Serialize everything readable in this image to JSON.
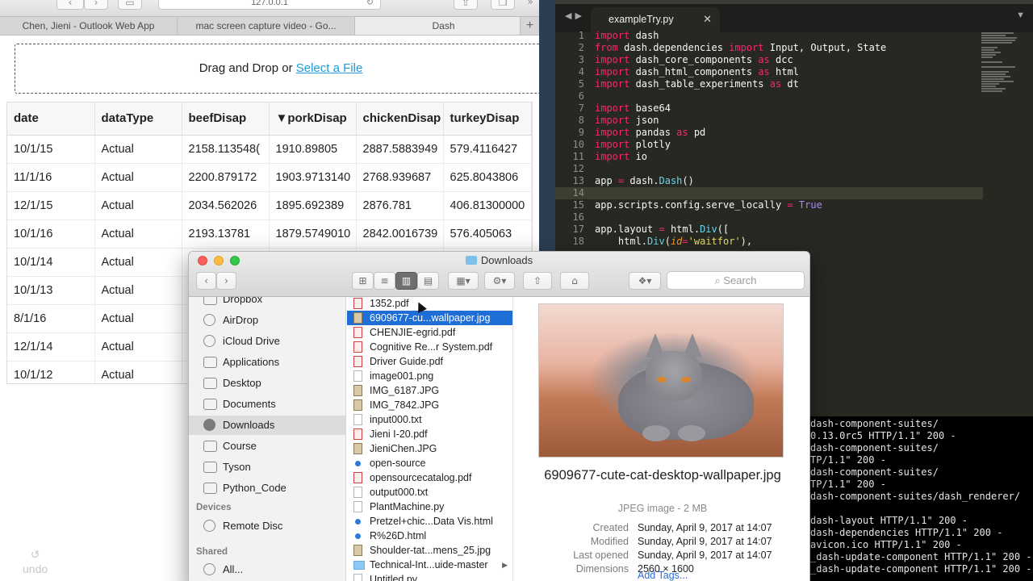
{
  "browser": {
    "url": "127.0.0.1",
    "tabs": [
      "Chen, Jieni - Outlook Web App",
      "mac screen capture video - Go...",
      "Dash"
    ],
    "dropzone": {
      "prefix": "Drag and Drop or ",
      "link": "Select a File"
    },
    "table": {
      "headers": [
        "date",
        "dataType",
        "beefDisap",
        "▼porkDisap",
        "chickenDisap",
        "turkeyDisap"
      ],
      "rows": [
        [
          "10/1/15",
          "Actual",
          "2158.113548(",
          "1910.89805",
          "2887.5883949",
          "579.4116427"
        ],
        [
          "11/1/16",
          "Actual",
          "2200.879172",
          "1903.9713140",
          "2768.939687",
          "625.8043806"
        ],
        [
          "12/1/15",
          "Actual",
          "2034.562026",
          "1895.692389",
          "2876.781",
          "406.81300000"
        ],
        [
          "10/1/16",
          "Actual",
          "2193.13781",
          "1879.5749010",
          "2842.0016739",
          "576.405063"
        ],
        [
          "10/1/14",
          "Actual",
          "",
          "",
          "",
          ""
        ],
        [
          "10/1/13",
          "Actual",
          "",
          "",
          "",
          ""
        ],
        [
          "8/1/16",
          "Actual",
          "",
          "",
          "",
          ""
        ],
        [
          "12/1/14",
          "Actual",
          "",
          "",
          "",
          ""
        ],
        [
          "10/1/12",
          "Actual",
          "",
          "",
          "",
          ""
        ]
      ]
    },
    "undo_label": "undo"
  },
  "editor": {
    "tab": "exampleTry.py",
    "lines": [
      "import dash",
      "from dash.dependencies import Input, Output, State",
      "import dash_core_components as dcc",
      "import dash_html_components as html",
      "import dash_table_experiments as dt",
      "",
      "import base64",
      "import json",
      "import pandas as pd",
      "import plotly",
      "import io",
      "",
      "app = dash.Dash()",
      "",
      "app.scripts.config.serve_locally = True",
      "",
      "app.layout = html.Div([",
      "    html.Div(id='waitfor'),"
    ]
  },
  "terminal": {
    "lines": [
      "dash-component-suites/",
      "0.13.0rc5 HTTP/1.1\" 200 -",
      "dash-component-suites/",
      "TP/1.1\" 200 -",
      "dash-component-suites/",
      "TP/1.1\" 200 -",
      "dash-component-suites/dash_renderer/",
      "",
      "dash-layout HTTP/1.1\" 200 -",
      "dash-dependencies HTTP/1.1\" 200 -",
      "avicon.ico HTTP/1.1\" 200 -",
      "_dash-update-component HTTP/1.1\" 200 -",
      "_dash-update-component HTTP/1.1\" 200 -"
    ]
  },
  "finder": {
    "title": "Downloads",
    "search_placeholder": "Search",
    "sidebar": {
      "favorites": [
        "Dropbox",
        "AirDrop",
        "iCloud Drive",
        "Applications",
        "Desktop",
        "Documents",
        "Downloads",
        "Course",
        "Tyson",
        "Python_Code"
      ],
      "selected": "Downloads",
      "devices_header": "Devices",
      "devices": [
        "Remote Disc"
      ],
      "shared_header": "Shared",
      "shared": [
        "All..."
      ]
    },
    "files": [
      {
        "name": "1352.pdf",
        "kind": "pdf"
      },
      {
        "name": "6909677-cu...wallpaper.jpg",
        "kind": "img"
      },
      {
        "name": "CHENJIE-egrid.pdf",
        "kind": "pdf"
      },
      {
        "name": "Cognitive Re...r System.pdf",
        "kind": "pdf"
      },
      {
        "name": "Driver Guide.pdf",
        "kind": "pdf"
      },
      {
        "name": "image001.png",
        "kind": "doc"
      },
      {
        "name": "IMG_6187.JPG",
        "kind": "img"
      },
      {
        "name": "IMG_7842.JPG",
        "kind": "img"
      },
      {
        "name": "input000.txt",
        "kind": "doc"
      },
      {
        "name": "Jieni I-20.pdf",
        "kind": "pdf"
      },
      {
        "name": "JieniChen.JPG",
        "kind": "img"
      },
      {
        "name": "open-source",
        "kind": "web"
      },
      {
        "name": "opensourcecatalog.pdf",
        "kind": "pdf"
      },
      {
        "name": "output000.txt",
        "kind": "doc"
      },
      {
        "name": "PlantMachine.py",
        "kind": "doc"
      },
      {
        "name": "Pretzel+chic...Data Vis.html",
        "kind": "web"
      },
      {
        "name": "R%26D.html",
        "kind": "web"
      },
      {
        "name": "Shoulder-tat...mens_25.jpg",
        "kind": "img"
      },
      {
        "name": "Technical-Int...uide-master",
        "kind": "folder"
      },
      {
        "name": "Untitled.py",
        "kind": "doc"
      }
    ],
    "selected_file": "6909677-cu...wallpaper.jpg",
    "preview": {
      "filename": "6909677-cute-cat-desktop-wallpaper.jpg",
      "kind": "JPEG image - 2 MB",
      "created_label": "Created",
      "created": "Sunday, April 9, 2017 at 14:07",
      "modified_label": "Modified",
      "modified": "Sunday, April 9, 2017 at 14:07",
      "opened_label": "Last opened",
      "opened": "Sunday, April 9, 2017 at 14:07",
      "dimensions_label": "Dimensions",
      "dimensions": "2560 × 1600",
      "add_tags": "Add Tags..."
    }
  },
  "colors": {
    "selection": "#1f6ed6",
    "link": "#1a9bd7",
    "editor_bg": "#272822",
    "keyword": "#f92672"
  }
}
